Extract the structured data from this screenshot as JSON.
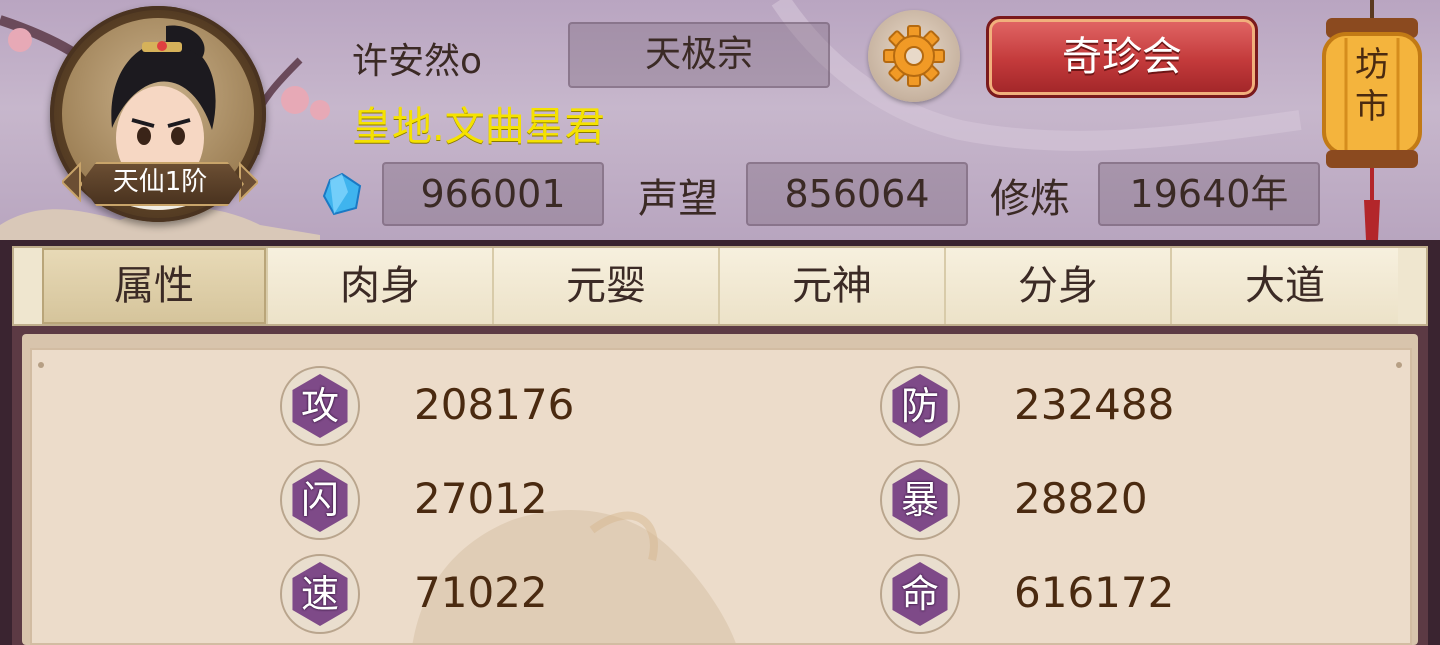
{
  "player": {
    "name": "许安然o",
    "sect": "天极宗",
    "title": "皇地.文曲星君",
    "rank": "天仙1阶"
  },
  "buttons": {
    "treasure": "奇珍会",
    "market": "坊市"
  },
  "resources": {
    "spirit_stones": "966001",
    "reputation_label": "声望",
    "reputation": "856064",
    "cultivation_label": "修炼",
    "cultivation": "19640年"
  },
  "tabs": [
    "属性",
    "肉身",
    "元婴",
    "元神",
    "分身",
    "大道"
  ],
  "active_tab": "属性",
  "stats": [
    {
      "label": "攻",
      "value": "208176"
    },
    {
      "label": "防",
      "value": "232488"
    },
    {
      "label": "闪",
      "value": "27012"
    },
    {
      "label": "暴",
      "value": "28820"
    },
    {
      "label": "速",
      "value": "71022"
    },
    {
      "label": "命",
      "value": "616172"
    }
  ],
  "colors": {
    "title_gold": "#f5e200",
    "hex_purple": "#7e4a88",
    "button_red": "#c33a3b"
  },
  "icons": [
    "gear-icon",
    "spirit-stone-icon",
    "lantern-icon"
  ]
}
